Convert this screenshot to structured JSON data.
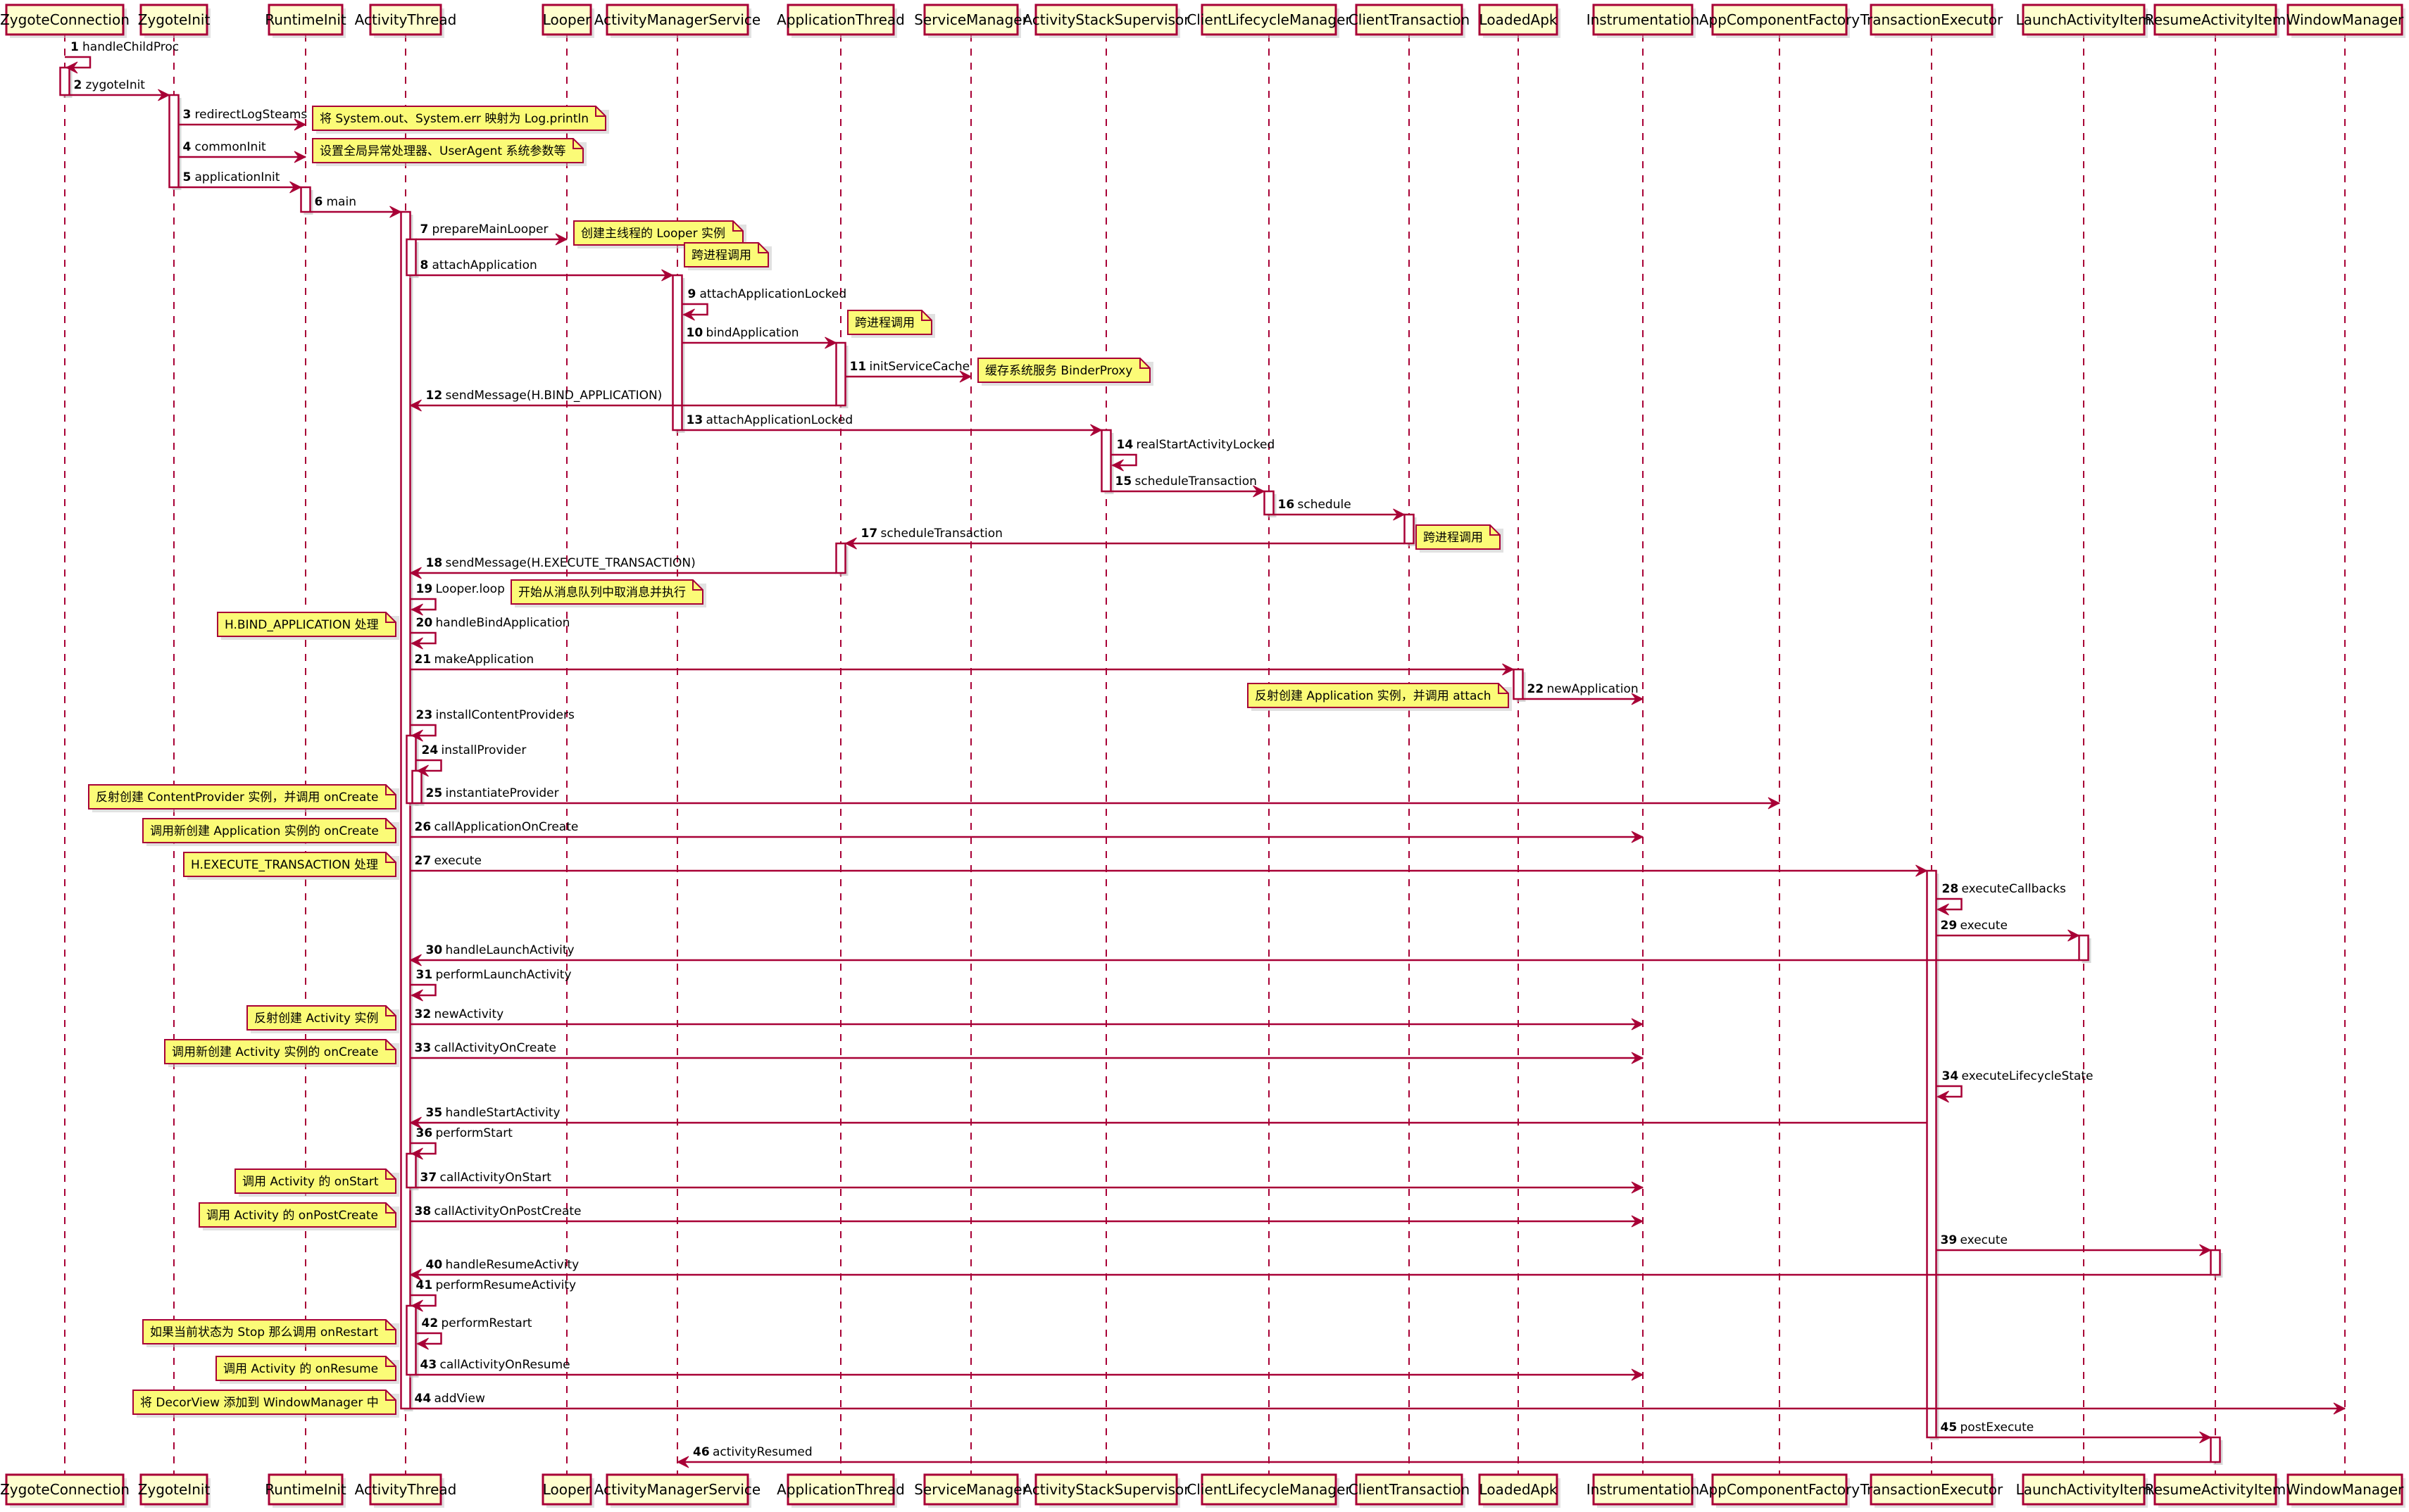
{
  "diagram": {
    "type": "sequence",
    "colors": {
      "participant_fill": "#FEFECE",
      "border": "#A80036",
      "note_fill": "#FBFB77",
      "activation_fill": "#FFFFFF"
    },
    "participants": [
      {
        "id": "ZygoteConnection",
        "label": "ZygoteConnection"
      },
      {
        "id": "ZygoteInit",
        "label": "ZygoteInit"
      },
      {
        "id": "RuntimeInit",
        "label": "RuntimeInit"
      },
      {
        "id": "ActivityThread",
        "label": "ActivityThread"
      },
      {
        "id": "Looper",
        "label": "Looper"
      },
      {
        "id": "ActivityManagerService",
        "label": "ActivityManagerService"
      },
      {
        "id": "ApplicationThread",
        "label": "ApplicationThread"
      },
      {
        "id": "ServiceManager",
        "label": "ServiceManager"
      },
      {
        "id": "ActivityStackSupervisor",
        "label": "ActivityStackSupervisor"
      },
      {
        "id": "ClientLifecycleManager",
        "label": "ClientLifecycleManager"
      },
      {
        "id": "ClientTransaction",
        "label": "ClientTransaction"
      },
      {
        "id": "LoadedApk",
        "label": "LoadedApk"
      },
      {
        "id": "Instrumentation",
        "label": "Instrumentation"
      },
      {
        "id": "AppComponentFactory",
        "label": "AppComponentFactory"
      },
      {
        "id": "TransactionExecutor",
        "label": "TransactionExecutor"
      },
      {
        "id": "LaunchActivityItem",
        "label": "LaunchActivityItem"
      },
      {
        "id": "ResumeActivityItem",
        "label": "ResumeActivityItem"
      },
      {
        "id": "WindowManager",
        "label": "WindowManager"
      }
    ],
    "messages": [
      {
        "num": "1",
        "label": "handleChildProc",
        "from": "ZygoteConnection",
        "to": "ZygoteConnection"
      },
      {
        "num": "2",
        "label": "zygoteInit",
        "from": "ZygoteConnection",
        "to": "ZygoteInit"
      },
      {
        "num": "3",
        "label": "redirectLogSteams",
        "from": "ZygoteInit",
        "to": "RuntimeInit",
        "note": "将 System.out、System.err 映射为 Log.println",
        "note_side": "right"
      },
      {
        "num": "4",
        "label": "commonInit",
        "from": "ZygoteInit",
        "to": "RuntimeInit",
        "note": "设置全局异常处理器、UserAgent 系统参数等",
        "note_side": "right"
      },
      {
        "num": "5",
        "label": "applicationInit",
        "from": "ZygoteInit",
        "to": "RuntimeInit"
      },
      {
        "num": "6",
        "label": "main",
        "from": "RuntimeInit",
        "to": "ActivityThread"
      },
      {
        "num": "7",
        "label": "prepareMainLooper",
        "from": "ActivityThread",
        "to": "Looper",
        "note": "创建主线程的 Looper 实例",
        "note_side": "right"
      },
      {
        "num": "8",
        "label": "attachApplication",
        "from": "ActivityThread",
        "to": "ActivityManagerService",
        "note": "跨进程调用",
        "note_side": "right"
      },
      {
        "num": "9",
        "label": "attachApplicationLocked",
        "from": "ActivityManagerService",
        "to": "ActivityManagerService"
      },
      {
        "num": "10",
        "label": "bindApplication",
        "from": "ActivityManagerService",
        "to": "ApplicationThread",
        "note": "跨进程调用",
        "note_side": "right"
      },
      {
        "num": "11",
        "label": "initServiceCache",
        "from": "ApplicationThread",
        "to": "ServiceManager",
        "note": "缓存系统服务 BinderProxy",
        "note_side": "right"
      },
      {
        "num": "12",
        "label": "sendMessage(H.BIND_APPLICATION)",
        "from": "ApplicationThread",
        "to": "ActivityThread"
      },
      {
        "num": "13",
        "label": "attachApplicationLocked",
        "from": "ActivityManagerService",
        "to": "ActivityStackSupervisor"
      },
      {
        "num": "14",
        "label": "realStartActivityLocked",
        "from": "ActivityStackSupervisor",
        "to": "ActivityStackSupervisor"
      },
      {
        "num": "15",
        "label": "scheduleTransaction",
        "from": "ActivityStackSupervisor",
        "to": "ClientLifecycleManager"
      },
      {
        "num": "16",
        "label": "schedule",
        "from": "ClientLifecycleManager",
        "to": "ClientTransaction"
      },
      {
        "num": "17",
        "label": "scheduleTransaction",
        "from": "ClientTransaction",
        "to": "ApplicationThread",
        "note": "跨进程调用",
        "note_side": "right"
      },
      {
        "num": "18",
        "label": "sendMessage(H.EXECUTE_TRANSACTION)",
        "from": "ApplicationThread",
        "to": "ActivityThread"
      },
      {
        "num": "19",
        "label": "Looper.loop",
        "from": "ActivityThread",
        "to": "ActivityThread",
        "note": "开始从消息队列中取消息并执行",
        "note_side": "right"
      },
      {
        "num": "20",
        "label": "handleBindApplication",
        "from": "ActivityThread",
        "to": "ActivityThread",
        "note": "H.BIND_APPLICATION 处理",
        "note_side": "left"
      },
      {
        "num": "21",
        "label": "makeApplication",
        "from": "ActivityThread",
        "to": "LoadedApk"
      },
      {
        "num": "22",
        "label": "newApplication",
        "from": "LoadedApk",
        "to": "Instrumentation",
        "note": "反射创建 Application 实例，并调用 attach",
        "note_side": "left"
      },
      {
        "num": "23",
        "label": "installContentProviders",
        "from": "ActivityThread",
        "to": "ActivityThread"
      },
      {
        "num": "24",
        "label": "installProvider",
        "from": "ActivityThread",
        "to": "ActivityThread"
      },
      {
        "num": "25",
        "label": "instantiateProvider",
        "from": "ActivityThread",
        "to": "AppComponentFactory",
        "note": "反射创建 ContentProvider 实例，并调用 onCreate",
        "note_side": "left"
      },
      {
        "num": "26",
        "label": "callApplicationOnCreate",
        "from": "ActivityThread",
        "to": "Instrumentation",
        "note": "调用新创建 Application 实例的 onCreate",
        "note_side": "left"
      },
      {
        "num": "27",
        "label": "execute",
        "from": "ActivityThread",
        "to": "TransactionExecutor",
        "note": "H.EXECUTE_TRANSACTION 处理",
        "note_side": "left"
      },
      {
        "num": "28",
        "label": "executeCallbacks",
        "from": "TransactionExecutor",
        "to": "TransactionExecutor"
      },
      {
        "num": "29",
        "label": "execute",
        "from": "TransactionExecutor",
        "to": "LaunchActivityItem"
      },
      {
        "num": "30",
        "label": "handleLaunchActivity",
        "from": "LaunchActivityItem",
        "to": "ActivityThread"
      },
      {
        "num": "31",
        "label": "performLaunchActivity",
        "from": "ActivityThread",
        "to": "ActivityThread"
      },
      {
        "num": "32",
        "label": "newActivity",
        "from": "ActivityThread",
        "to": "Instrumentation",
        "note": "反射创建 Activity 实例",
        "note_side": "left"
      },
      {
        "num": "33",
        "label": "callActivityOnCreate",
        "from": "ActivityThread",
        "to": "Instrumentation",
        "note": "调用新创建 Activity 实例的 onCreate",
        "note_side": "left"
      },
      {
        "num": "34",
        "label": "executeLifecycleState",
        "from": "TransactionExecutor",
        "to": "TransactionExecutor"
      },
      {
        "num": "35",
        "label": "handleStartActivity",
        "from": "TransactionExecutor",
        "to": "ActivityThread"
      },
      {
        "num": "36",
        "label": "performStart",
        "from": "ActivityThread",
        "to": "ActivityThread"
      },
      {
        "num": "37",
        "label": "callActivityOnStart",
        "from": "ActivityThread",
        "to": "Instrumentation",
        "note": "调用 Activity 的 onStart",
        "note_side": "left"
      },
      {
        "num": "38",
        "label": "callActivityOnPostCreate",
        "from": "ActivityThread",
        "to": "Instrumentation",
        "note": "调用 Activity 的 onPostCreate",
        "note_side": "left"
      },
      {
        "num": "39",
        "label": "execute",
        "from": "TransactionExecutor",
        "to": "ResumeActivityItem"
      },
      {
        "num": "40",
        "label": "handleResumeActivity",
        "from": "ResumeActivityItem",
        "to": "ActivityThread"
      },
      {
        "num": "41",
        "label": "performResumeActivity",
        "from": "ActivityThread",
        "to": "ActivityThread"
      },
      {
        "num": "42",
        "label": "performRestart",
        "from": "ActivityThread",
        "to": "ActivityThread",
        "note": "如果当前状态为 Stop 那么调用 onRestart",
        "note_side": "left"
      },
      {
        "num": "43",
        "label": "callActivityOnResume",
        "from": "ActivityThread",
        "to": "Instrumentation",
        "note": "调用 Activity 的 onResume",
        "note_side": "left"
      },
      {
        "num": "44",
        "label": "addView",
        "from": "ActivityThread",
        "to": "WindowManager",
        "note": "将 DecorView 添加到 WindowManager 中",
        "note_side": "left"
      },
      {
        "num": "45",
        "label": "postExecute",
        "from": "TransactionExecutor",
        "to": "ResumeActivityItem"
      },
      {
        "num": "46",
        "label": "activityResumed",
        "from": "ResumeActivityItem",
        "to": "ActivityManagerService"
      }
    ]
  }
}
